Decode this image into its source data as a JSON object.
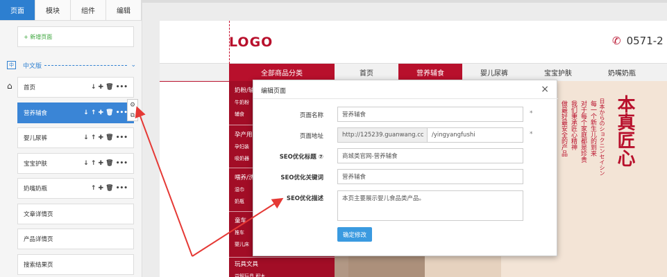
{
  "sidebar": {
    "tabs": [
      {
        "label": "页面",
        "active": true
      },
      {
        "label": "模块",
        "active": false
      },
      {
        "label": "组件",
        "active": false
      },
      {
        "label": "编辑",
        "active": false
      }
    ],
    "add_page": "+ 新增页面",
    "language": "中文版",
    "home_icon": "home-icon",
    "pages": [
      {
        "label": "首页",
        "actions": "↓ ✚ 🗑 •••",
        "active": false
      },
      {
        "label": "营养辅食",
        "actions": "↓ ↑ ✚ 🗑 •••",
        "active": true
      },
      {
        "label": "婴儿尿裤",
        "actions": "↓ ↑ ✚ 🗑 •••",
        "active": false
      },
      {
        "label": "宝宝护肤",
        "actions": "↓ ↑ ✚ 🗑 •••",
        "active": false
      },
      {
        "label": "奶嘴奶瓶",
        "actions": "↑ ✚ 🗑 •••",
        "active": false
      },
      {
        "label": "文章详情页",
        "actions": "",
        "active": false
      },
      {
        "label": "产品详情页",
        "actions": "",
        "active": false
      },
      {
        "label": "搜索结果页",
        "actions": "",
        "active": false
      }
    ]
  },
  "site": {
    "logo": "LOGO",
    "phone": "0571-2",
    "nav_category": "全部商品分类",
    "nav_items": [
      {
        "label": "首页",
        "active": false
      },
      {
        "label": "营养辅食",
        "active": true
      },
      {
        "label": "婴儿尿裤",
        "active": false
      },
      {
        "label": "宝宝护肤",
        "active": false
      },
      {
        "label": "奶嘴奶瓶",
        "active": false
      }
    ],
    "categories": [
      {
        "title": "奶粉/辅",
        "sub1": "牛奶粉",
        "sub2": "辅食"
      },
      {
        "title": "孕产用",
        "sub1": "孕妇装",
        "sub2": "吸奶器"
      },
      {
        "title": "喂养/洗",
        "sub1": "湿巾",
        "sub2": "奶瓶"
      },
      {
        "title": "童车",
        "sub1": "推车",
        "sub2": "婴儿床"
      },
      {
        "title": "玩具文具",
        "sub1": "益智玩具 积木",
        "sub2": ""
      }
    ],
    "banner_text_big": "本真匠心",
    "banner_text_jp": "日本からのショクニンセイシン",
    "banner_text_cn1": "每一个新生儿的到来",
    "banner_text_cn2": "对于每个家庭都是珍贵",
    "banner_text_cn3": "我们秉承匠心精神",
    "banner_text_cn4": "做最好最安全的产品"
  },
  "modal": {
    "title": "编辑页面",
    "close": "×",
    "fields": {
      "page_name_label": "页面名称",
      "page_name_value": "营养辅食",
      "page_url_label": "页面地址",
      "page_url_prefix": "http://125239.guanwang.cc",
      "page_url_value": "/yingyangfushi",
      "seo_title_label": "SEO优化标题 ⑦",
      "seo_title_value": "商城类官网-营养辅食",
      "seo_keywords_label": "SEO优化关键词",
      "seo_keywords_value": "营养辅食",
      "seo_desc_label": "SEO优化描述",
      "seo_desc_value": "本页主要展示婴儿食品类产品。",
      "required_mark": "*"
    },
    "submit": "确定修改"
  },
  "colors": {
    "accent_blue": "#2d7fd0",
    "brand_red": "#b8102c",
    "annotation_red": "#e53935"
  }
}
